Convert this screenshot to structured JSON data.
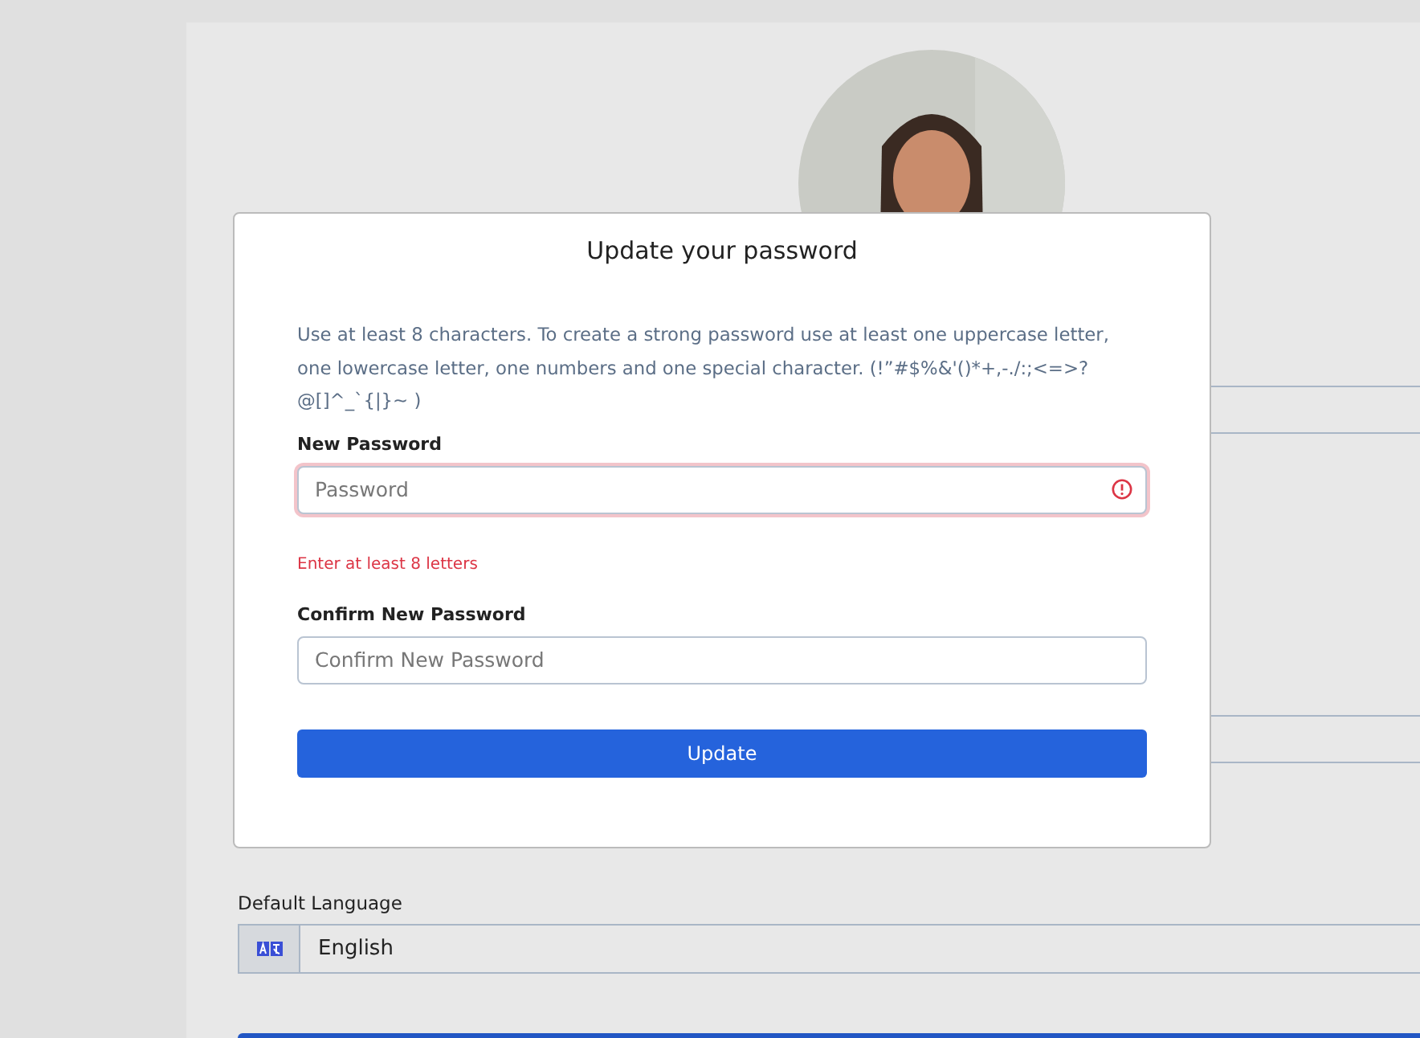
{
  "profile": {
    "default_language": {
      "label": "Default Language",
      "value": "English"
    }
  },
  "dialog": {
    "title": "Update your password",
    "hint": "Use at least 8 characters. To create a strong password use at least one uppercase letter, one lowercase letter, one numbers and one special character. (!”#$%&'()*+,-./:;<=>?@[]^_`{|}~ )",
    "fields": [
      {
        "label": "New Password",
        "placeholder": "Password",
        "error": true,
        "error_text": "Enter at least 8 letters"
      },
      {
        "label": "Confirm New Password",
        "placeholder": "Confirm New Password",
        "error": false
      }
    ],
    "button": "Update"
  }
}
